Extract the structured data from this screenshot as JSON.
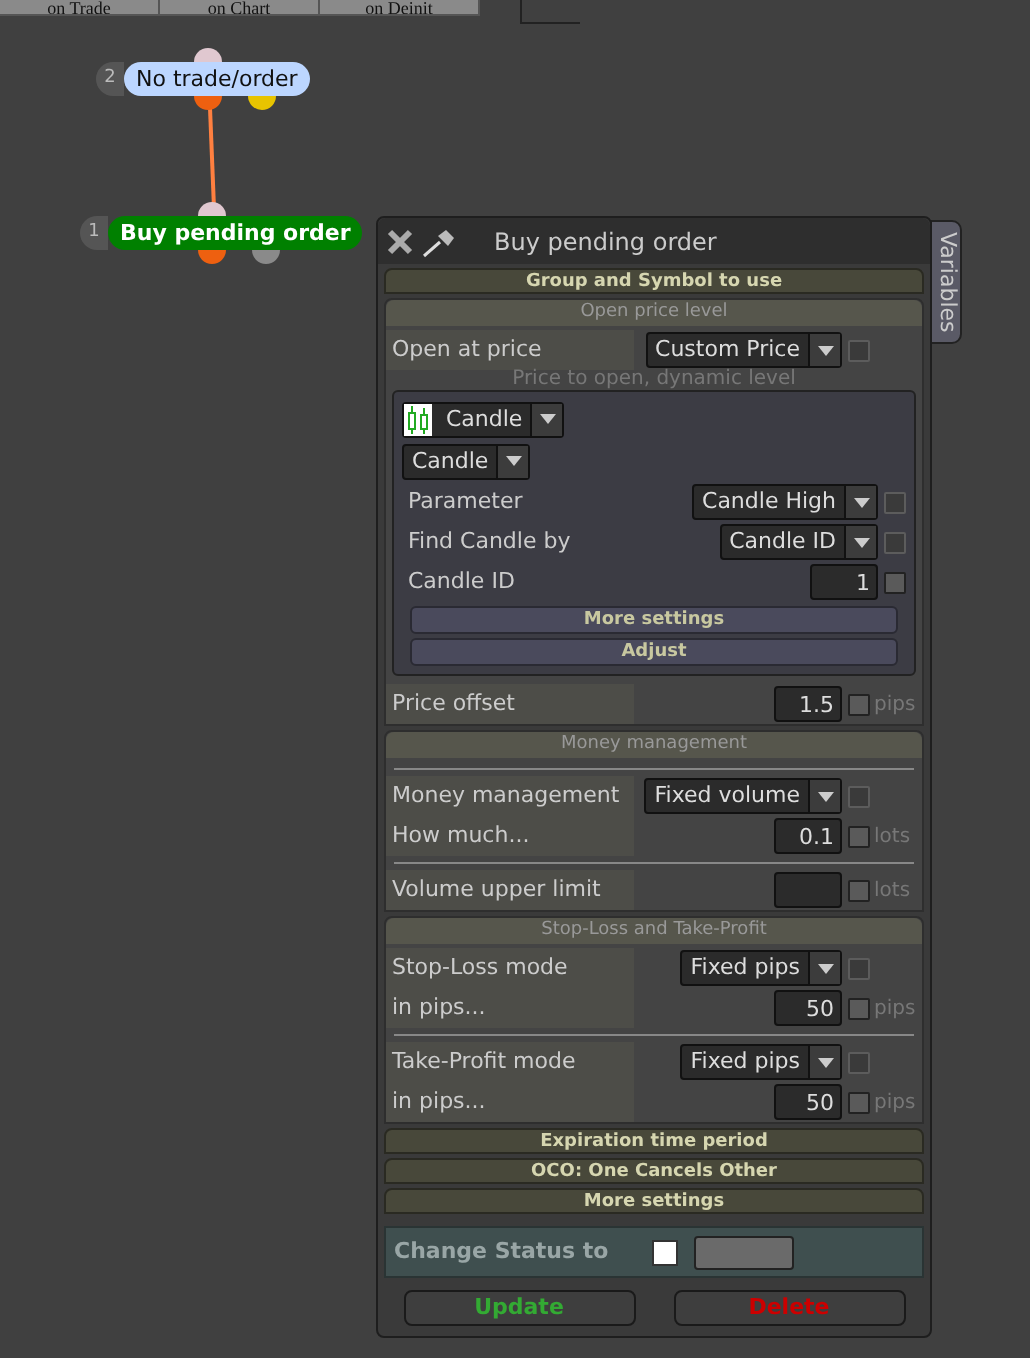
{
  "tabs": [
    {
      "label": "on Trade"
    },
    {
      "label": "on Chart"
    },
    {
      "label": "on Deinit"
    }
  ],
  "nodes": [
    {
      "number": "2",
      "label": "No trade/order",
      "color": "#bcd6ff"
    },
    {
      "number": "1",
      "label": "Buy pending order",
      "color": "#008000"
    }
  ],
  "panel": {
    "title": "Buy pending order",
    "side_tab": "Variables",
    "sections": [
      {
        "title": "Group and Symbol to use",
        "expanded": false
      },
      {
        "title": "Open price level",
        "expanded": true,
        "rows": [
          {
            "kind": "select",
            "label": "Open at price",
            "value": "Custom Price",
            "checked": false,
            "disabled": true
          },
          {
            "kind": "caption",
            "text": "Price to open, dynamic level"
          },
          {
            "kind": "panel",
            "rows": [
              {
                "kind": "icon_select",
                "value": "Candle"
              },
              {
                "kind": "plain_select",
                "value": "Candle"
              },
              {
                "kind": "select",
                "label": "Parameter",
                "value": "Candle High",
                "checked": false,
                "disabled": true
              },
              {
                "kind": "select",
                "label": "Find Candle by",
                "value": "Candle ID",
                "checked": false,
                "disabled": true
              },
              {
                "kind": "number",
                "label": "Candle ID",
                "value": "1",
                "checked": false
              },
              {
                "kind": "button",
                "label": "More settings"
              },
              {
                "kind": "button",
                "label": "Adjust"
              }
            ]
          },
          {
            "kind": "number",
            "label": "Price offset",
            "value": "1.5",
            "checked": false,
            "unit": "pips"
          }
        ]
      },
      {
        "title": "Money management",
        "expanded": true,
        "rows": [
          {
            "kind": "divider"
          },
          {
            "kind": "select",
            "label": "Money management",
            "value": "Fixed volume",
            "checked": false,
            "disabled": true
          },
          {
            "kind": "number",
            "label": "How much...",
            "value": "0.1",
            "checked": false,
            "unit": "lots"
          },
          {
            "kind": "divider"
          },
          {
            "kind": "number",
            "label": "Volume upper limit",
            "checked": false,
            "unit": "lots"
          }
        ]
      },
      {
        "title": "Stop-Loss and Take-Profit",
        "expanded": true,
        "rows": [
          {
            "kind": "select",
            "label": "Stop-Loss mode",
            "value": "Fixed pips",
            "checked": false,
            "disabled": true
          },
          {
            "kind": "number",
            "label": "in pips...",
            "value": "50",
            "checked": false,
            "unit": "pips"
          },
          {
            "kind": "divider"
          },
          {
            "kind": "select",
            "label": "Take-Profit mode",
            "value": "Fixed pips",
            "checked": false,
            "disabled": true
          },
          {
            "kind": "number",
            "label": "in pips...",
            "value": "50",
            "checked": false,
            "unit": "pips"
          }
        ]
      },
      {
        "title": "Expiration time period",
        "expanded": false
      },
      {
        "title": "OCO: One Cancels Other",
        "expanded": false
      },
      {
        "title": "More settings",
        "expanded": false
      }
    ],
    "status": {
      "label": "Change Status to",
      "checked": false
    },
    "buttons": [
      {
        "label": "Update",
        "color": "#33aa33"
      },
      {
        "label": "Delete",
        "color": "#cc0000"
      }
    ]
  }
}
